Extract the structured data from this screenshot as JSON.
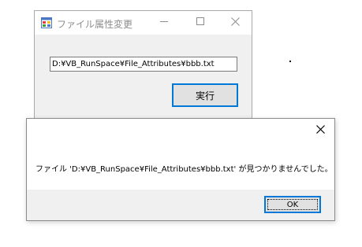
{
  "main_window": {
    "title": "ファイル属性変更",
    "icon": "app-window-icon",
    "controls": {
      "minimize_icon": "minimize-icon",
      "maximize_icon": "maximize-icon",
      "close_icon": "close-icon"
    },
    "path_input": {
      "value": "D:¥VB_RunSpace¥File_Attributes¥bbb.txt"
    },
    "run_button": {
      "label": "実行"
    }
  },
  "message_box": {
    "message": "ファイル 'D:¥VB_RunSpace¥File_Attributes¥bbb.txt' が見つかりませんでした。",
    "ok_label": "OK",
    "close_icon": "close-icon"
  },
  "colors": {
    "accent": "#0078d7",
    "window_bg": "#f0f0f0",
    "button_bg": "#e1e1e1",
    "title_text": "#8c8c8c"
  }
}
